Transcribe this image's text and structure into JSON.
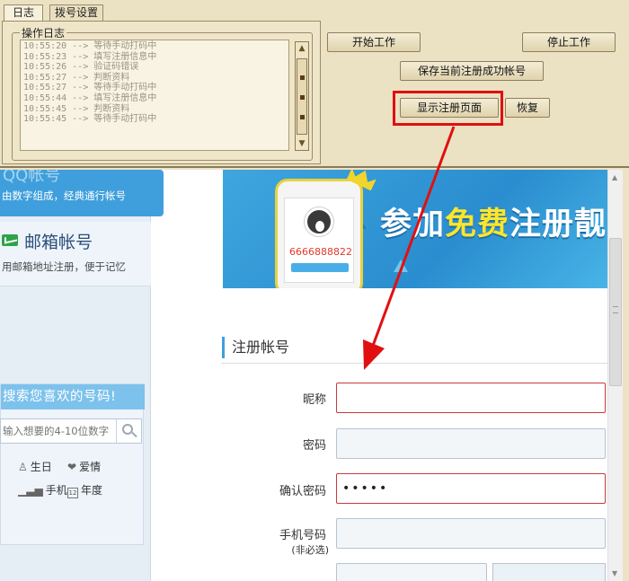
{
  "tabs": {
    "log": "日志",
    "dial": "拨号设置"
  },
  "log_group": {
    "title": "操作日志",
    "lines": [
      "10:55:20 --> 等待手动打码中",
      "10:55:23 --> 填写注册信息中",
      "10:55:26 --> 验证码错误",
      "10:55:27 --> 判断资料",
      "10:55:27 --> 等待手动打码中",
      "10:55:44 --> 填写注册信息中",
      "10:55:45 --> 判断资料",
      "10:55:45 --> 等待手动打码中"
    ]
  },
  "buttons": {
    "start": "开始工作",
    "stop": "停止工作",
    "save": "保存当前注册成功帐号",
    "show": "显示注册页面",
    "restore": "恢复"
  },
  "left": {
    "qq_title": "QQ帐号",
    "qq_desc": "由数字组成，经典通行帐号",
    "mail_title": "邮箱帐号",
    "mail_desc": "用邮箱地址注册，便于记忆",
    "search_title": "搜索您喜欢的号码!",
    "search_placeholder": "输入想要的4-10位数字",
    "filters": {
      "birthday": "生日",
      "love": "爱情",
      "phone": "手机",
      "year": "年度"
    },
    "year_icon": "12"
  },
  "banner": {
    "phone_number": "6666888822",
    "text_pre": "参加",
    "text_em": "免费",
    "text_post": "注册靓号"
  },
  "form": {
    "section_title": "注册帐号",
    "nickname_label": "昵称",
    "password_label": "密码",
    "confirm_label": "确认密码",
    "confirm_value": "•••••",
    "phone_label": "手机号码",
    "phone_optional": "(非必选)"
  },
  "colors": {
    "highlight": "#e01010",
    "accent": "#3f9fdc"
  }
}
